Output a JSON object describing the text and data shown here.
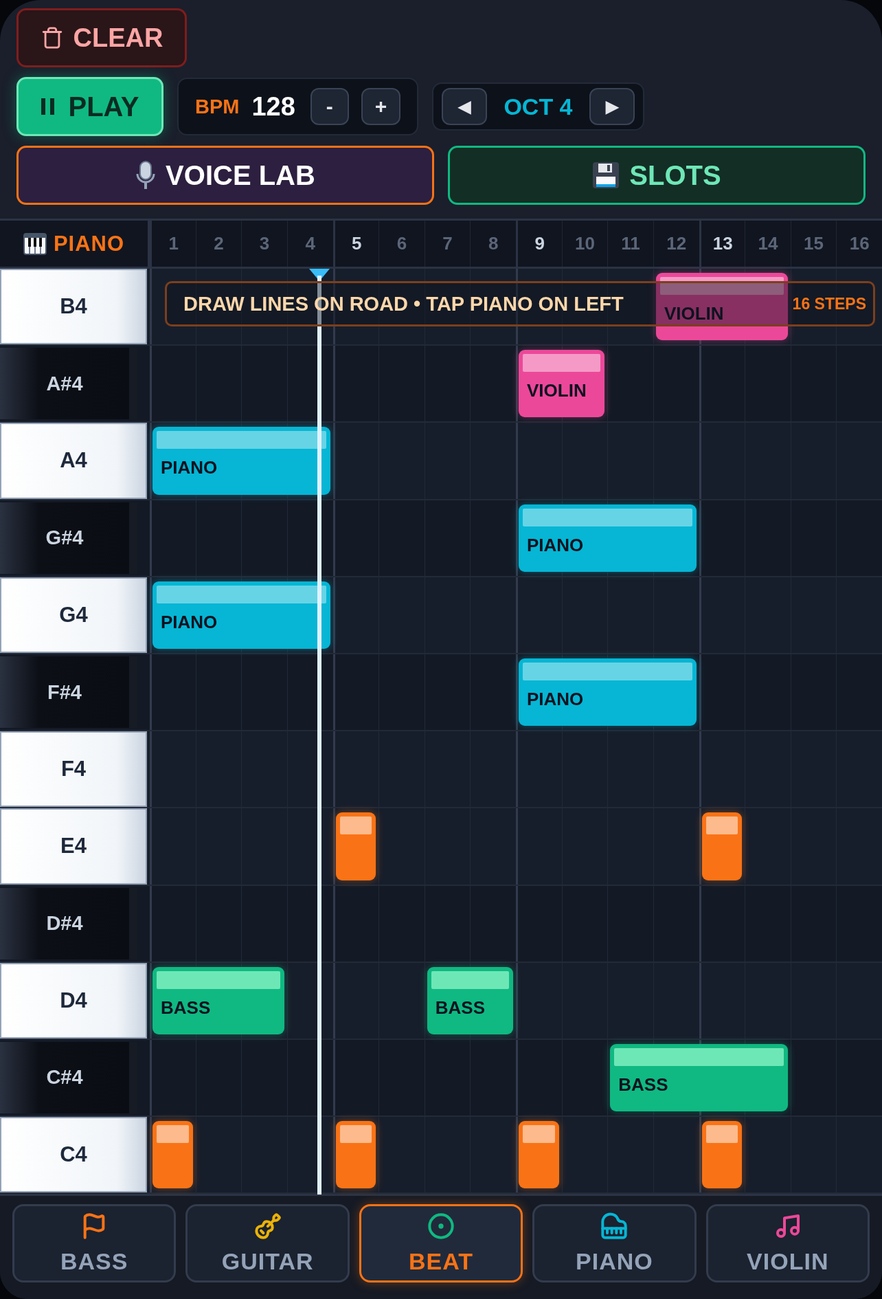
{
  "toolbar": {
    "clear": "CLEAR",
    "play": {
      "label": "PLAY",
      "playing": true
    },
    "bpm": {
      "label": "BPM",
      "value": "128",
      "minus": "-",
      "plus": "+"
    },
    "octave": {
      "prev": "◀",
      "label": "OCT 4",
      "next": "▶"
    },
    "voice_lab": "VOICE LAB",
    "slots": "SLOTS"
  },
  "grid": {
    "instrument": "PIANO",
    "steps": [
      {
        "label": "1",
        "accent": false
      },
      {
        "label": "2",
        "accent": false
      },
      {
        "label": "3",
        "accent": false
      },
      {
        "label": "4",
        "accent": false
      },
      {
        "label": "5",
        "accent": true
      },
      {
        "label": "6",
        "accent": false
      },
      {
        "label": "7",
        "accent": false
      },
      {
        "label": "8",
        "accent": false
      },
      {
        "label": "9",
        "accent": true
      },
      {
        "label": "10",
        "accent": false
      },
      {
        "label": "11",
        "accent": false
      },
      {
        "label": "12",
        "accent": false
      },
      {
        "label": "13",
        "accent": true
      },
      {
        "label": "14",
        "accent": false
      },
      {
        "label": "15",
        "accent": false
      },
      {
        "label": "16",
        "accent": false
      }
    ],
    "playhead": {
      "level": 0.232
    },
    "banner": {
      "text": "DRAW LINES ON ROAD • TAP PIANO ON LEFT",
      "steps": "16 STEPS"
    },
    "rows": [
      {
        "note": "B4",
        "kind": "white",
        "cells": [
          {
            "kind": "rest"
          },
          {
            "kind": "rest"
          },
          {
            "kind": "rest"
          },
          {
            "kind": "rest"
          },
          {
            "kind": "rest"
          },
          {
            "kind": "rest"
          },
          {
            "kind": "rest"
          },
          {
            "kind": "rest"
          },
          {
            "kind": "rest"
          },
          {
            "kind": "rest"
          },
          {
            "kind": "rest"
          },
          {
            "kind": "violin",
            "label": "VIOLIN"
          },
          {
            "kind": "tie"
          },
          {
            "kind": "tie"
          },
          {
            "kind": "rest"
          },
          {
            "kind": "rest"
          }
        ]
      },
      {
        "note": "A#4",
        "kind": "black",
        "cells": [
          {
            "kind": "rest"
          },
          {
            "kind": "rest"
          },
          {
            "kind": "rest"
          },
          {
            "kind": "rest"
          },
          {
            "kind": "rest"
          },
          {
            "kind": "rest"
          },
          {
            "kind": "rest"
          },
          {
            "kind": "rest"
          },
          {
            "kind": "violin",
            "label": "VIOLIN"
          },
          {
            "kind": "tie"
          },
          {
            "kind": "rest"
          },
          {
            "kind": "rest"
          },
          {
            "kind": "rest"
          },
          {
            "kind": "rest"
          },
          {
            "kind": "rest"
          },
          {
            "kind": "rest"
          }
        ]
      },
      {
        "note": "A4",
        "kind": "white",
        "cells": [
          {
            "kind": "piano",
            "label": "PIANO"
          },
          {
            "kind": "tie"
          },
          {
            "kind": "tie"
          },
          {
            "kind": "tie"
          },
          {
            "kind": "rest"
          },
          {
            "kind": "rest"
          },
          {
            "kind": "rest"
          },
          {
            "kind": "rest"
          },
          {
            "kind": "rest"
          },
          {
            "kind": "rest"
          },
          {
            "kind": "rest"
          },
          {
            "kind": "rest"
          },
          {
            "kind": "rest"
          },
          {
            "kind": "rest"
          },
          {
            "kind": "rest"
          },
          {
            "kind": "rest"
          }
        ]
      },
      {
        "note": "G#4",
        "kind": "black",
        "cells": [
          {
            "kind": "rest"
          },
          {
            "kind": "rest"
          },
          {
            "kind": "rest"
          },
          {
            "kind": "rest"
          },
          {
            "kind": "rest"
          },
          {
            "kind": "rest"
          },
          {
            "kind": "rest"
          },
          {
            "kind": "rest"
          },
          {
            "kind": "piano",
            "label": "PIANO"
          },
          {
            "kind": "tie"
          },
          {
            "kind": "tie"
          },
          {
            "kind": "tie"
          },
          {
            "kind": "rest"
          },
          {
            "kind": "rest"
          },
          {
            "kind": "rest"
          },
          {
            "kind": "rest"
          }
        ]
      },
      {
        "note": "G4",
        "kind": "white",
        "cells": [
          {
            "kind": "piano",
            "label": "PIANO"
          },
          {
            "kind": "tie"
          },
          {
            "kind": "tie"
          },
          {
            "kind": "tie"
          },
          {
            "kind": "rest"
          },
          {
            "kind": "rest"
          },
          {
            "kind": "rest"
          },
          {
            "kind": "rest"
          },
          {
            "kind": "rest"
          },
          {
            "kind": "rest"
          },
          {
            "kind": "rest"
          },
          {
            "kind": "rest"
          },
          {
            "kind": "rest"
          },
          {
            "kind": "rest"
          },
          {
            "kind": "rest"
          },
          {
            "kind": "rest"
          }
        ]
      },
      {
        "note": "F#4",
        "kind": "black",
        "cells": [
          {
            "kind": "rest"
          },
          {
            "kind": "rest"
          },
          {
            "kind": "rest"
          },
          {
            "kind": "rest"
          },
          {
            "kind": "rest"
          },
          {
            "kind": "rest"
          },
          {
            "kind": "rest"
          },
          {
            "kind": "rest"
          },
          {
            "kind": "piano",
            "label": "PIANO"
          },
          {
            "kind": "tie"
          },
          {
            "kind": "tie"
          },
          {
            "kind": "tie"
          },
          {
            "kind": "rest"
          },
          {
            "kind": "rest"
          },
          {
            "kind": "rest"
          },
          {
            "kind": "rest"
          }
        ]
      },
      {
        "note": "F4",
        "kind": "white",
        "cells": [
          {
            "kind": "rest"
          },
          {
            "kind": "rest"
          },
          {
            "kind": "rest"
          },
          {
            "kind": "rest"
          },
          {
            "kind": "rest"
          },
          {
            "kind": "rest"
          },
          {
            "kind": "rest"
          },
          {
            "kind": "rest"
          },
          {
            "kind": "rest"
          },
          {
            "kind": "rest"
          },
          {
            "kind": "rest"
          },
          {
            "kind": "rest"
          },
          {
            "kind": "rest"
          },
          {
            "kind": "rest"
          },
          {
            "kind": "rest"
          },
          {
            "kind": "rest"
          }
        ]
      },
      {
        "note": "E4",
        "kind": "white",
        "cells": [
          {
            "kind": "rest"
          },
          {
            "kind": "rest"
          },
          {
            "kind": "rest"
          },
          {
            "kind": "rest"
          },
          {
            "kind": "beat"
          },
          {
            "kind": "rest"
          },
          {
            "kind": "rest"
          },
          {
            "kind": "rest"
          },
          {
            "kind": "rest"
          },
          {
            "kind": "rest"
          },
          {
            "kind": "rest"
          },
          {
            "kind": "rest"
          },
          {
            "kind": "beat"
          },
          {
            "kind": "rest"
          },
          {
            "kind": "rest"
          },
          {
            "kind": "rest"
          }
        ]
      },
      {
        "note": "D#4",
        "kind": "black",
        "cells": [
          {
            "kind": "rest"
          },
          {
            "kind": "rest"
          },
          {
            "kind": "rest"
          },
          {
            "kind": "rest"
          },
          {
            "kind": "rest"
          },
          {
            "kind": "rest"
          },
          {
            "kind": "rest"
          },
          {
            "kind": "rest"
          },
          {
            "kind": "rest"
          },
          {
            "kind": "rest"
          },
          {
            "kind": "rest"
          },
          {
            "kind": "rest"
          },
          {
            "kind": "rest"
          },
          {
            "kind": "rest"
          },
          {
            "kind": "rest"
          },
          {
            "kind": "rest"
          }
        ]
      },
      {
        "note": "D4",
        "kind": "white",
        "cells": [
          {
            "kind": "bass",
            "label": "BASS"
          },
          {
            "kind": "tie"
          },
          {
            "kind": "tie"
          },
          {
            "kind": "rest"
          },
          {
            "kind": "rest"
          },
          {
            "kind": "rest"
          },
          {
            "kind": "bass",
            "label": "BASS"
          },
          {
            "kind": "tie"
          },
          {
            "kind": "rest"
          },
          {
            "kind": "rest"
          },
          {
            "kind": "rest"
          },
          {
            "kind": "rest"
          },
          {
            "kind": "rest"
          },
          {
            "kind": "rest"
          },
          {
            "kind": "rest"
          },
          {
            "kind": "rest"
          }
        ]
      },
      {
        "note": "C#4",
        "kind": "black",
        "cells": [
          {
            "kind": "rest"
          },
          {
            "kind": "rest"
          },
          {
            "kind": "rest"
          },
          {
            "kind": "rest"
          },
          {
            "kind": "rest"
          },
          {
            "kind": "rest"
          },
          {
            "kind": "rest"
          },
          {
            "kind": "rest"
          },
          {
            "kind": "rest"
          },
          {
            "kind": "rest"
          },
          {
            "kind": "bass",
            "label": "BASS"
          },
          {
            "kind": "tie"
          },
          {
            "kind": "tie"
          },
          {
            "kind": "tie"
          },
          {
            "kind": "rest"
          },
          {
            "kind": "rest"
          }
        ]
      },
      {
        "note": "C4",
        "kind": "white",
        "cells": [
          {
            "kind": "beat"
          },
          {
            "kind": "rest"
          },
          {
            "kind": "rest"
          },
          {
            "kind": "rest"
          },
          {
            "kind": "beat"
          },
          {
            "kind": "rest"
          },
          {
            "kind": "rest"
          },
          {
            "kind": "rest"
          },
          {
            "kind": "beat"
          },
          {
            "kind": "rest"
          },
          {
            "kind": "rest"
          },
          {
            "kind": "rest"
          },
          {
            "kind": "beat"
          },
          {
            "kind": "rest"
          },
          {
            "kind": "rest"
          },
          {
            "kind": "rest"
          }
        ]
      }
    ]
  },
  "tabs": [
    {
      "kind": "bass",
      "label": "BASS",
      "selected": false
    },
    {
      "kind": "guitar",
      "label": "GUITAR",
      "selected": false
    },
    {
      "kind": "beat",
      "label": "BEAT",
      "selected": true
    },
    {
      "kind": "piano",
      "label": "PIANO",
      "selected": false
    },
    {
      "kind": "violin",
      "label": "VIOLIN",
      "selected": false
    }
  ]
}
